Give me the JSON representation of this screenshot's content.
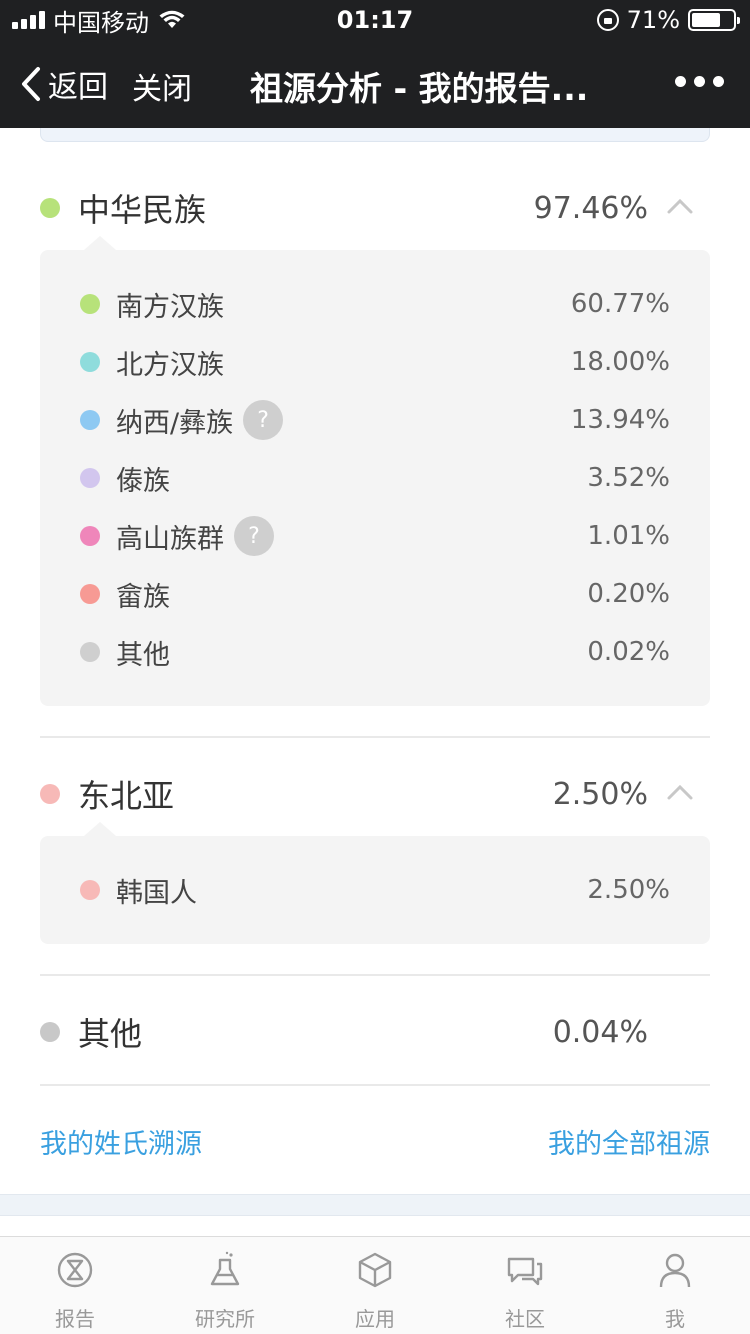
{
  "status_bar": {
    "carrier": "中国移动",
    "time": "01:17",
    "battery": "71%",
    "battery_level": 0.71
  },
  "nav": {
    "back_label": "返回",
    "close_label": "关闭",
    "title": "祖源分析 - 我的报告..."
  },
  "groups": [
    {
      "name": "中华民族",
      "percent": "97.46%",
      "color": "#b7e27a",
      "items": [
        {
          "name": "南方汉族",
          "percent": "60.77%",
          "color": "#b7e27a",
          "help": false
        },
        {
          "name": "北方汉族",
          "percent": "18.00%",
          "color": "#8fdcdc",
          "help": false
        },
        {
          "name": "纳西/彝族",
          "percent": "13.94%",
          "color": "#8ec9f2",
          "help": true
        },
        {
          "name": "傣族",
          "percent": "3.52%",
          "color": "#d2c6ee",
          "help": false
        },
        {
          "name": "高山族群",
          "percent": "1.01%",
          "color": "#ef86ba",
          "help": true
        },
        {
          "name": "畲族",
          "percent": "0.20%",
          "color": "#f79a94",
          "help": false
        },
        {
          "name": "其他",
          "percent": "0.02%",
          "color": "#cfcfcf",
          "help": false
        }
      ]
    },
    {
      "name": "东北亚",
      "percent": "2.50%",
      "color": "#f7b9b7",
      "items": [
        {
          "name": "韩国人",
          "percent": "2.50%",
          "color": "#f7b9b7",
          "help": false
        }
      ]
    },
    {
      "name": "其他",
      "percent": "0.04%",
      "color": "#c8c8c8",
      "items": []
    }
  ],
  "help_glyph": "?",
  "links": {
    "surname": "我的姓氏溯源",
    "all_ancestry": "我的全部祖源"
  },
  "tabs": [
    {
      "label": "报告",
      "icon": "dna-report-icon"
    },
    {
      "label": "研究所",
      "icon": "flask-icon"
    },
    {
      "label": "应用",
      "icon": "cube-icon"
    },
    {
      "label": "社区",
      "icon": "chat-bubbles-icon"
    },
    {
      "label": "我",
      "icon": "person-icon"
    }
  ]
}
